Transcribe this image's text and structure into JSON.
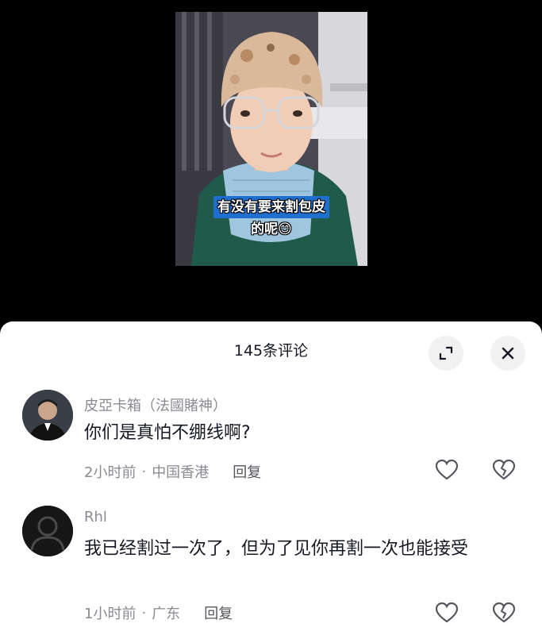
{
  "video": {
    "caption_line1": "有没有要来割包皮",
    "caption_line2": "的呢😊"
  },
  "comments_panel": {
    "title": "145条评论",
    "expand_icon": "expand-icon",
    "close_icon": "close-icon"
  },
  "comments": [
    {
      "author": "皮亞卡箱（法國賭神）",
      "text": "你们是真怕不绷线啊?",
      "time": "2小时前",
      "location": "中国香港",
      "reply_label": "回复",
      "separator": "·"
    },
    {
      "author": "Rhl",
      "text": "我已经割过一次了，但为了见你再割一次也能接受",
      "time": "1小时前",
      "location": "广东",
      "reply_label": "回复",
      "separator": "·"
    }
  ],
  "colors": {
    "sheet_bg": "#ffffff",
    "text_primary": "#161823",
    "text_secondary": "#8a8b91",
    "caption_bg": "#1f6fcf"
  }
}
